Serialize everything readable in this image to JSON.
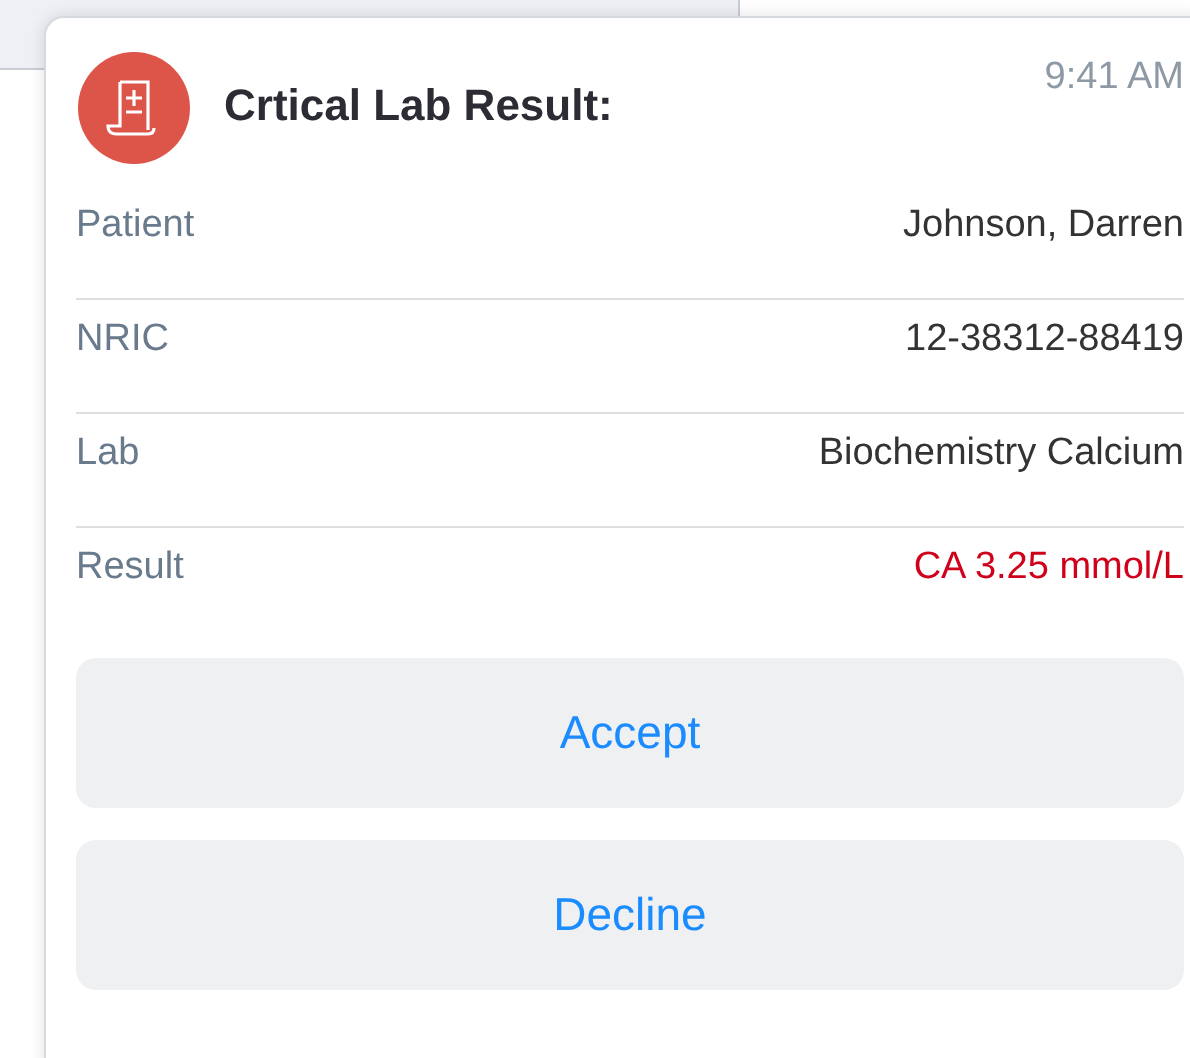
{
  "notification": {
    "title": "Crtical Lab Result:",
    "time": "9:41 AM",
    "fields": [
      {
        "label": "Patient",
        "value": "Johnson, Darren",
        "kind": "normal"
      },
      {
        "label": "NRIC",
        "value": "12-38312-88419",
        "kind": "normal"
      },
      {
        "label": "Lab",
        "value": "Biochemistry Calcium",
        "kind": "normal"
      },
      {
        "label": "Result",
        "value": "CA 3.25 mmol/L",
        "kind": "critical"
      }
    ],
    "buttons": [
      "Accept",
      "Decline"
    ]
  }
}
